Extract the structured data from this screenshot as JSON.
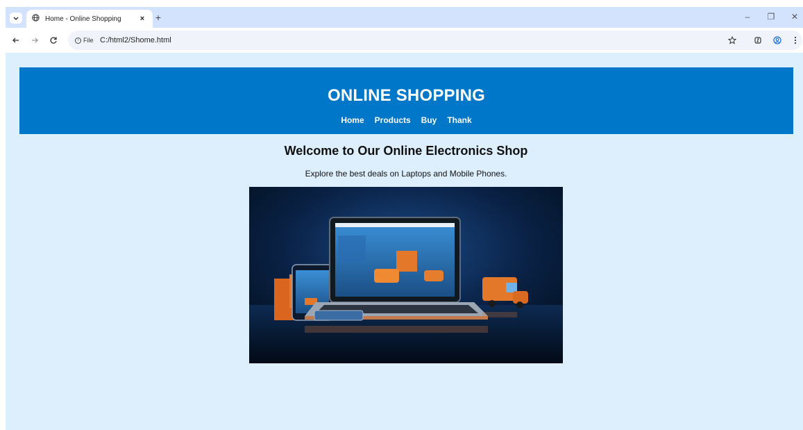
{
  "browser": {
    "tab": {
      "title": "Home - Online Shopping",
      "close_glyph": "×"
    },
    "new_tab_glyph": "+",
    "site_info_label": "File",
    "url": "C:/html2/Shome.html",
    "window_controls": {
      "minimize": "–",
      "restore": "❐",
      "close": "✕"
    }
  },
  "page": {
    "header": {
      "title": "ONLINE SHOPPING",
      "nav": [
        "Home",
        "Products",
        "Buy",
        "Thank"
      ]
    },
    "welcome_heading": "Welcome to Our Online Electronics Shop",
    "tagline": "Explore the best deals on Laptops and Mobile Phones."
  },
  "colors": {
    "browser_chrome": "#d3e3fd",
    "page_background": "#ddeefd",
    "header_background": "#0077c8",
    "header_text": "#ffffff"
  },
  "icons": {
    "tab_search": "chevron-down-icon",
    "tab_favicon": "globe-icon",
    "back": "arrow-left-icon",
    "forward": "arrow-right-icon",
    "reload": "reload-icon",
    "site_info": "info-icon",
    "bookmark": "star-icon",
    "extensions": "puzzle-icon",
    "profile": "profile-icon",
    "menu": "more-vertical-icon"
  }
}
